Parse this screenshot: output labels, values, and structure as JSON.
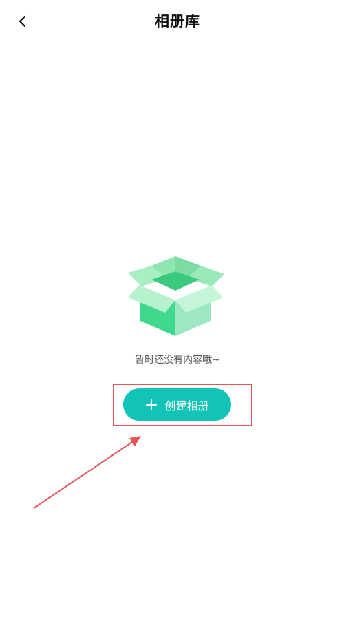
{
  "header": {
    "title": "相册库",
    "back_icon": "chevron-left-icon"
  },
  "empty_state": {
    "illustration": "open-box-illustration",
    "message": "暂时还没有内容哦~"
  },
  "create_button": {
    "label": "创建相册",
    "icon": "plus-icon",
    "color": "#12c3b8"
  },
  "annotation": {
    "highlight_color": "#e25656"
  }
}
